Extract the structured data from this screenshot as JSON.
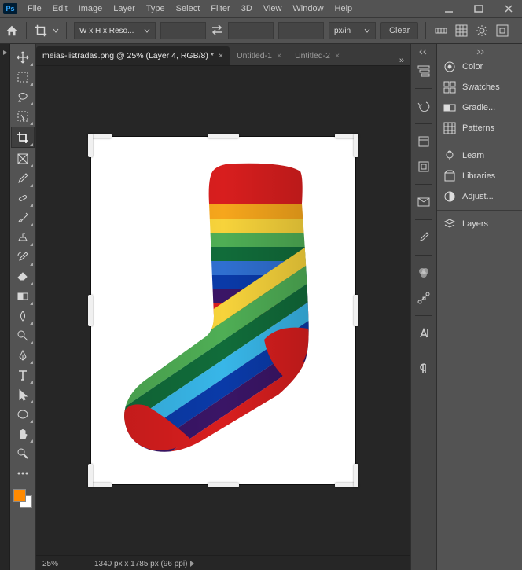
{
  "menu": {
    "items": [
      "File",
      "Edit",
      "Image",
      "Layer",
      "Type",
      "Select",
      "Filter",
      "3D",
      "View",
      "Window",
      "Help"
    ]
  },
  "optbar": {
    "preset_label": "W x H x Reso...",
    "units_label": "px/in",
    "clear_label": "Clear"
  },
  "tabs": {
    "items": [
      {
        "label": "meias-listradas.png @ 25% (Layer 4, RGB/8) *",
        "active": true
      },
      {
        "label": "Untitled-1",
        "active": false
      },
      {
        "label": "Untitled-2",
        "active": false
      }
    ]
  },
  "panels": {
    "group1": [
      "Color",
      "Swatches",
      "Gradie...",
      "Patterns"
    ],
    "group2": [
      "Learn",
      "Libraries",
      "Adjust..."
    ],
    "group3": [
      "Layers"
    ]
  },
  "status": {
    "zoom": "25%",
    "dimensions": "1340 px x 1785 px (96 ppi)"
  },
  "swatch": {
    "front": "#ff8a00",
    "back": "#ffffff"
  }
}
